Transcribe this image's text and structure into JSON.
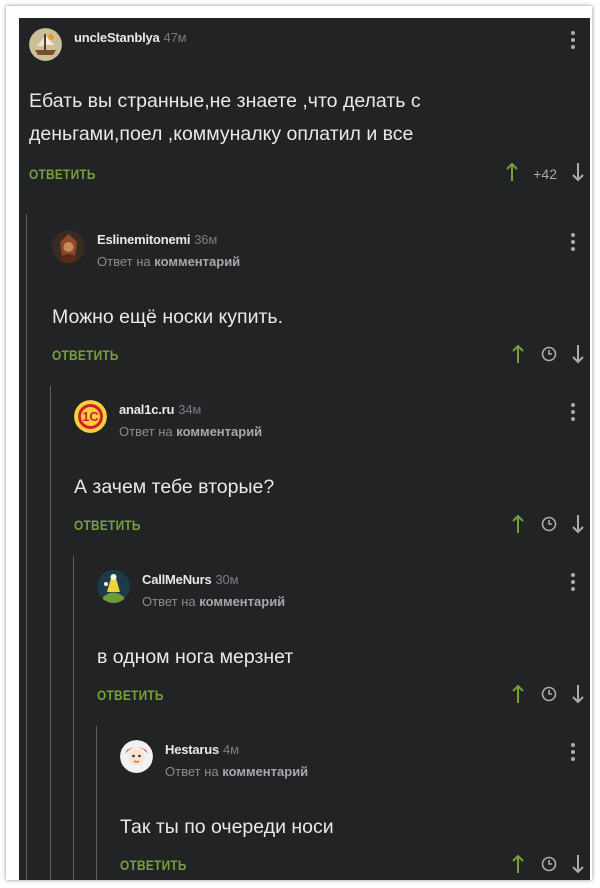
{
  "reply_label": "ОТВЕТИТЬ",
  "reply_to_prefix": "Ответ на",
  "reply_to_target": "комментарий",
  "colors": {
    "background": "#222325",
    "accent": "#76a03b",
    "up_arrow": "#76a03b",
    "down_arrow": "#a9abae"
  },
  "comments": [
    {
      "user": "uncleStanblya",
      "time": "47м",
      "text": [
        "Ебать вы странные,не знаете ,что делать с",
        "деньгами,поел ,коммуналку оплатил и все"
      ],
      "score": "+42",
      "avatar_icon": "ship-avatar"
    },
    {
      "user": "Eslinemitonemi",
      "time": "36м",
      "text": [
        "Можно ещё носки купить."
      ],
      "avatar_icon": "character-avatar"
    },
    {
      "user": "anal1c.ru",
      "time": "34м",
      "text": [
        "А зачем тебе вторые?"
      ],
      "avatar_icon": "1c-logo-avatar"
    },
    {
      "user": "CallMeNurs",
      "time": "30м",
      "text": [
        "в одном нога мерзнет"
      ],
      "avatar_icon": "cartoon-avatar"
    },
    {
      "user": "Hestarus",
      "time": "4м",
      "text": [
        "Так ты по очереди носи"
      ],
      "avatar_icon": "anime-avatar"
    }
  ]
}
